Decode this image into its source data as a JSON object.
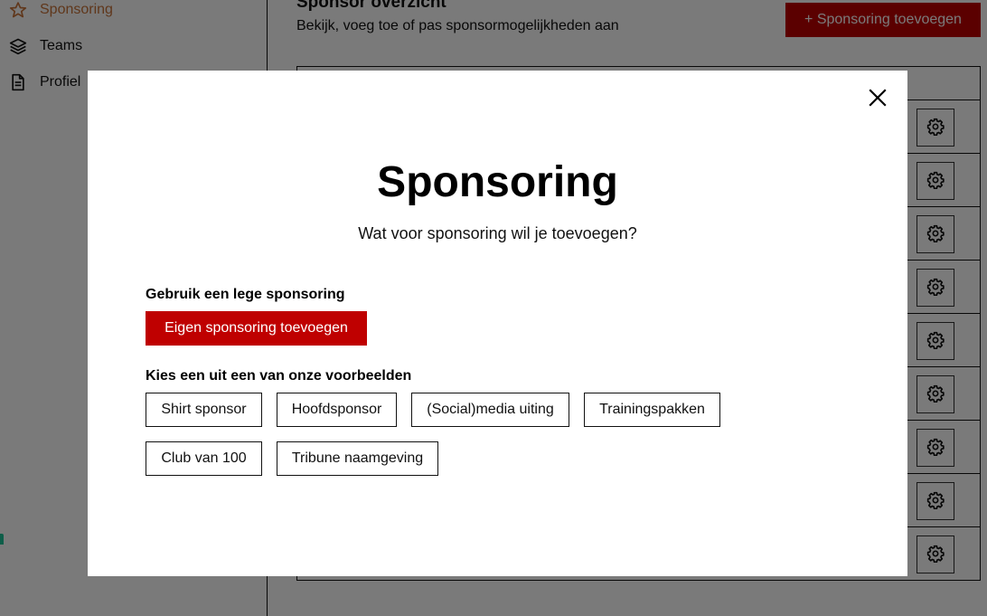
{
  "sidebar": {
    "items": [
      {
        "label": "Sponsoring",
        "icon": "star-icon",
        "active": true
      },
      {
        "label": "Teams",
        "icon": "layers-icon",
        "active": false
      },
      {
        "label": "Profiel",
        "icon": "document-icon",
        "active": false
      }
    ]
  },
  "main": {
    "title": "Sponsor overzicht",
    "subtitle": "Bekijk, voeg toe of pas sponsormogelijkheden aan",
    "add_button_label": "+ Sponsoring toevoegen",
    "row_count": 9,
    "row_action_icon": "gear-icon"
  },
  "modal": {
    "title": "Sponsoring",
    "subtitle": "Wat voor sponsoring wil je toevoegen?",
    "empty_section_label": "Gebruik een lege sponsoring",
    "empty_button_label": "Eigen sponsoring toevoegen",
    "examples_section_label": "Kies een uit een van onze voorbeelden",
    "examples": [
      "Shirt sponsor",
      "Hoofdsponsor",
      "(Social)media uiting",
      "Trainingspakken",
      "Club van 100",
      "Tribune naamgeving"
    ],
    "close_icon": "close-icon"
  },
  "colors": {
    "brand_red": "#bf0000",
    "active_nav": "#c8743a",
    "chat_widget_accent": "#1fc59a"
  }
}
